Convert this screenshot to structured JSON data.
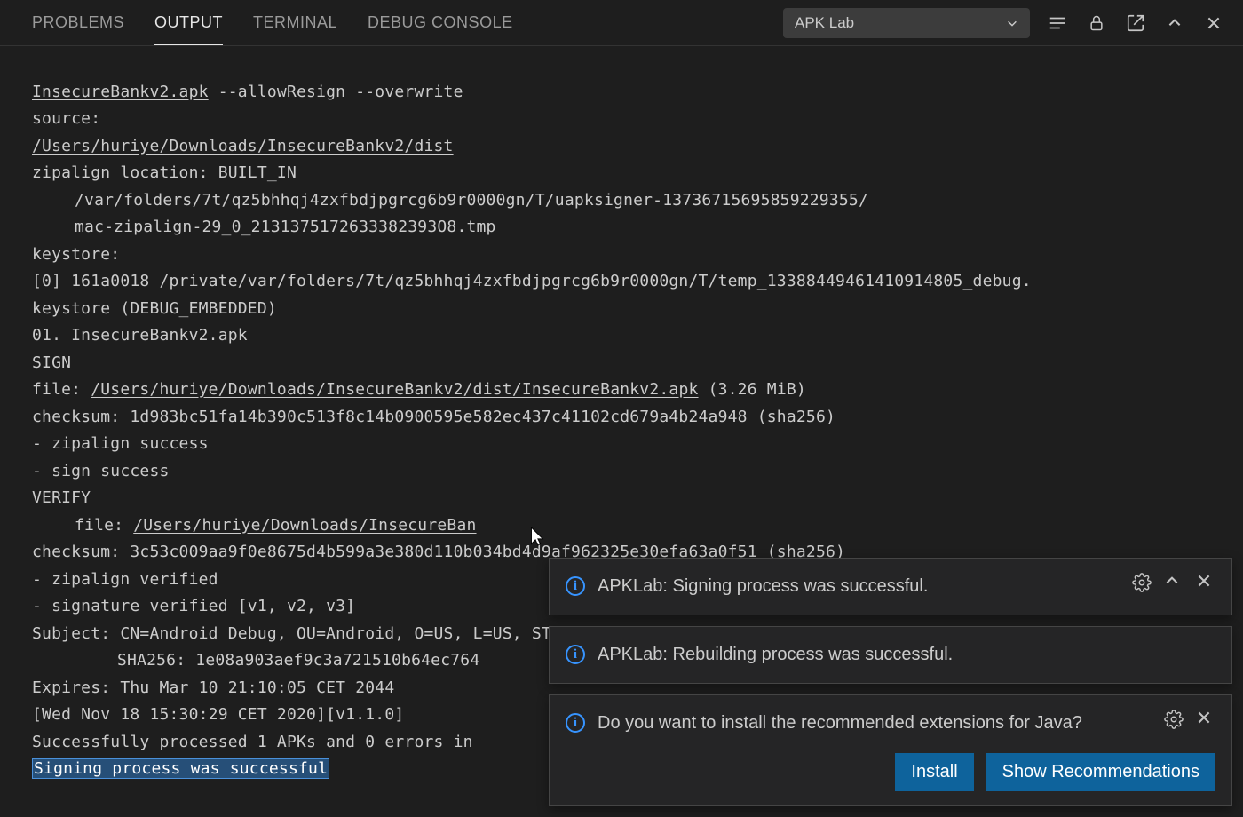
{
  "tabs": {
    "problems": "PROBLEMS",
    "output": "OUTPUT",
    "terminal": "TERMINAL",
    "debug": "DEBUG CONSOLE"
  },
  "dropdown": {
    "selected": "APK Lab"
  },
  "output_lines": {
    "l0a": "InsecureBankv2.apk",
    "l0b": " --allowResign --overwrite",
    "l1": "source:",
    "l2": "/Users/huriye/Downloads/InsecureBankv2/dist",
    "l3": "zipalign location: BUILT_IN",
    "l4": "/var/folders/7t/qz5bhhqj4zxfbdjpgrcg6b9r0000gn/T/uapksigner-13736715695859229355/",
    "l5": "mac-zipalign-29_0_2131375172633382393O8.tmp",
    "l6": "keystore:",
    "l7": "[0] 161a0018 /private/var/folders/7t/qz5bhhqj4zxfbdjpgrcg6b9r0000gn/T/temp_13388449461410914805_debug.",
    "l8": "keystore (DEBUG_EMBEDDED)",
    "l9": "01. InsecureBankv2.apk",
    "l10": "SIGN",
    "l11a": "file: ",
    "l11b": "/Users/huriye/Downloads/InsecureBankv2/dist/InsecureBankv2.apk",
    "l11c": " (3.26 MiB)",
    "l12": "checksum: 1d983bc51fa14b390c513f8c14b0900595e582ec437c41102cd679a4b24a948 (sha256)",
    "l13": "- zipalign success",
    "l14": "- sign success",
    "l15": "VERIFY",
    "l16a": "file: ",
    "l16b": "/Users/huriye/Downloads/InsecureBan",
    "l17": "checksum: 3c53c009aa9f0e8675d4b599a3e380d110b034bd4d9af962325e30efa63a0f51 (sha256)",
    "l18": "- zipalign verified",
    "l19": "- signature verified [v1, v2, v3]",
    "l20": "Subject: CN=Android Debug, OU=Android, O=US, L=US, ST=US, C=US",
    "l21": "SHA256: 1e08a903aef9c3a721510b64ec764",
    "l22": "Expires: Thu Mar 10 21:10:05 CET 2044",
    "l23": "[Wed Nov 18 15:30:29 CET 2020][v1.1.0]",
    "l24": "Successfully processed 1 APKs and 0 errors in",
    "l25": "Signing process was successful"
  },
  "notifications": {
    "n1": "APKLab: Signing process was successful.",
    "n2": "APKLab: Rebuilding process was successful.",
    "n3": "Do you want to install the recommended extensions for Java?",
    "install": "Install",
    "show_rec": "Show Recommendations"
  }
}
